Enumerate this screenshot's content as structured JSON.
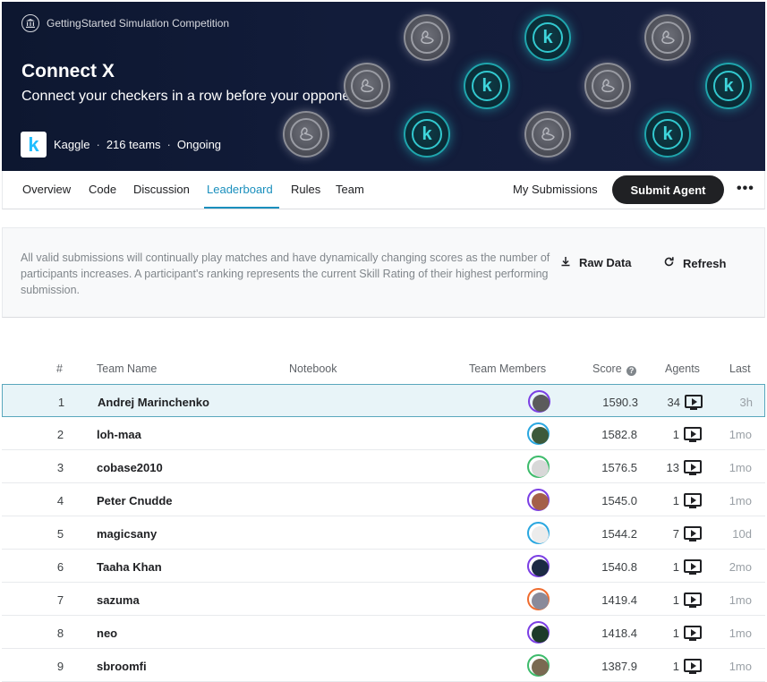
{
  "header": {
    "competition_type": "GettingStarted Simulation Competition",
    "title": "Connect X",
    "subtitle": "Connect your checkers in a row before your opponent!",
    "host": "Kaggle",
    "teams": "216 teams",
    "status": "Ongoing",
    "host_logo_letter": "k",
    "separator": "·"
  },
  "nav": {
    "tabs": [
      {
        "label": "Overview"
      },
      {
        "label": "Code"
      },
      {
        "label": "Discussion"
      },
      {
        "label": "Leaderboard"
      },
      {
        "label": "Rules"
      },
      {
        "label": "Team"
      }
    ],
    "active_tab": "Leaderboard",
    "my_submissions": "My Submissions",
    "submit_agent": "Submit Agent",
    "more_icon": "more-horizontal-icon"
  },
  "info": {
    "description": "All valid submissions will continually play matches and have dynamically changing scores as the number of participants increases. A participant's ranking represents the current Skill Rating of their highest performing submission.",
    "raw_data": "Raw Data",
    "refresh": "Refresh"
  },
  "table": {
    "headers": {
      "rank": "#",
      "team_name": "Team Name",
      "notebook": "Notebook",
      "team_members": "Team Members",
      "score": "Score",
      "agents": "Agents",
      "last": "Last"
    },
    "rows": [
      {
        "rank": "1",
        "name": "Andrej Marinchenko",
        "score": "1590.3",
        "agents": "34",
        "last": "3h"
      },
      {
        "rank": "2",
        "name": "loh-maa",
        "score": "1582.8",
        "agents": "1",
        "last": "1mo"
      },
      {
        "rank": "3",
        "name": "cobase2010",
        "score": "1576.5",
        "agents": "13",
        "last": "1mo"
      },
      {
        "rank": "4",
        "name": "Peter Cnudde",
        "score": "1545.0",
        "agents": "1",
        "last": "1mo"
      },
      {
        "rank": "5",
        "name": "magicsany",
        "score": "1544.2",
        "agents": "7",
        "last": "10d"
      },
      {
        "rank": "6",
        "name": "Taaha Khan",
        "score": "1540.8",
        "agents": "1",
        "last": "2mo"
      },
      {
        "rank": "7",
        "name": "sazuma",
        "score": "1419.4",
        "agents": "1",
        "last": "1mo"
      },
      {
        "rank": "8",
        "name": "neo",
        "score": "1418.4",
        "agents": "1",
        "last": "1mo"
      },
      {
        "rank": "9",
        "name": "sbroomfi",
        "score": "1387.9",
        "agents": "1",
        "last": "1mo"
      }
    ]
  },
  "colors": {
    "accent": "#1a8fbd",
    "banner": "#121c3a",
    "selected_row": "#e8f4f8"
  }
}
